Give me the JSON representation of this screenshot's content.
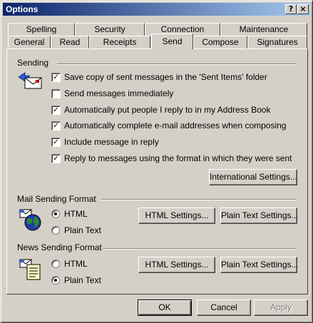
{
  "window": {
    "title": "Options",
    "help_btn": "?",
    "close_btn": "×"
  },
  "tabs": {
    "row1": [
      "Spelling",
      "Security",
      "Connection",
      "Maintenance"
    ],
    "row2": [
      "General",
      "Read",
      "Receipts",
      "Send",
      "Compose",
      "Signatures"
    ],
    "active": "Send"
  },
  "sending": {
    "label": "Sending",
    "icon": "envelope-send-icon",
    "options": [
      {
        "label": "Save copy of sent messages in the 'Sent Items' folder",
        "checked": true
      },
      {
        "label": "Send messages immediately",
        "checked": false
      },
      {
        "label": "Automatically put people I reply to in my Address Book",
        "checked": true
      },
      {
        "label": "Automatically complete e-mail addresses when composing",
        "checked": true
      },
      {
        "label": "Include message in reply",
        "checked": true
      },
      {
        "label": "Reply to messages using the format in which they were sent",
        "checked": true
      }
    ],
    "intl_button": "International Settings..."
  },
  "mail_format": {
    "label": "Mail Sending Format",
    "icon": "globe-mail-icon",
    "html_label": "HTML",
    "plain_label": "Plain Text",
    "selected": "HTML",
    "html_settings": "HTML Settings...",
    "plain_settings": "Plain Text Settings..."
  },
  "news_format": {
    "label": "News Sending Format",
    "icon": "news-document-icon",
    "html_label": "HTML",
    "plain_label": "Plain Text",
    "selected": "Plain Text",
    "html_settings": "HTML Settings...",
    "plain_settings": "Plain Text Settings..."
  },
  "footer": {
    "ok": "OK",
    "cancel": "Cancel",
    "apply": "Apply"
  },
  "colors": {
    "titlebar_start": "#0a246a",
    "titlebar_end": "#a6caf0",
    "face": "#d4d0c8"
  }
}
